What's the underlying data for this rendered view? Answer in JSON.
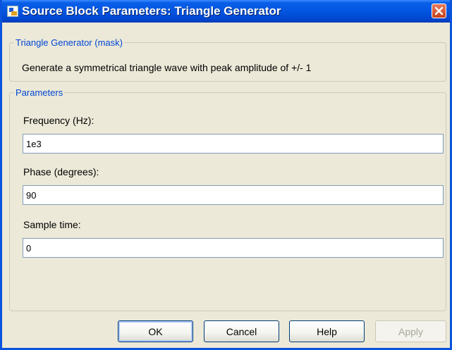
{
  "window": {
    "title": "Source Block Parameters: Triangle Generator"
  },
  "mask_group": {
    "legend": "Triangle Generator (mask)",
    "description": "Generate a symmetrical triangle wave with peak amplitude of +/- 1"
  },
  "params_group": {
    "legend": "Parameters",
    "fields": [
      {
        "label": "Frequency (Hz):",
        "value": "1e3"
      },
      {
        "label": "Phase (degrees):",
        "value": "90"
      },
      {
        "label": "Sample time:",
        "value": "0"
      }
    ]
  },
  "buttons": {
    "ok": "OK",
    "cancel": "Cancel",
    "help": "Help",
    "apply": "Apply"
  },
  "icons": {
    "window": "simulink-block-icon",
    "close": "close-icon"
  },
  "colors": {
    "titlebar": "#0255e0",
    "legend_text": "#0046d5",
    "close_button": "#d7552f"
  }
}
